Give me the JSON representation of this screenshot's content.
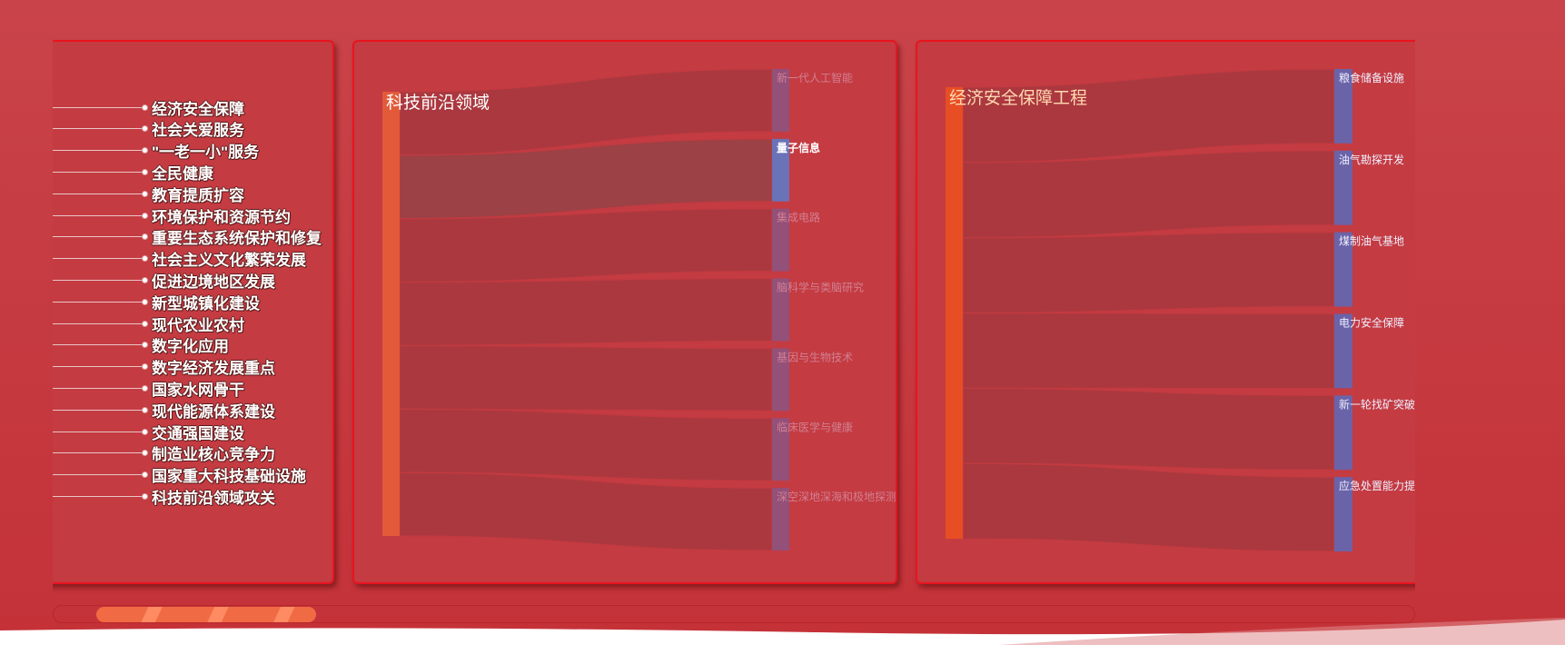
{
  "list_panel": {
    "items": [
      "经济安全保障",
      "社会关爱服务",
      "\"一老一小\"服务",
      "全民健康",
      "教育提质扩容",
      "环境保护和资源节约",
      "重要生态系统保护和修复",
      "社会主义文化繁荣发展",
      "促进边境地区发展",
      "新型城镇化建设",
      "现代农业农村",
      "数字化应用",
      "数字经济发展重点",
      "国家水网骨干",
      "现代能源体系建设",
      "交通强国建设",
      "制造业核心竞争力",
      "国家重大科技基础设施",
      "科技前沿领域攻关"
    ]
  },
  "tech_panel": {
    "source_label": "科技前沿领域",
    "targets": [
      "新一代人工智能",
      "量子信息",
      "集成电路",
      "脑科学与类脑研究",
      "基因与生物技术",
      "临床医学与健康",
      "深空深地深海和极地探测"
    ],
    "highlighted_index": 1
  },
  "econ_panel": {
    "source_label": "经济安全保障工程",
    "targets": [
      "粮食储备设施",
      "油气勘探开发",
      "煤制油气基地",
      "电力安全保障",
      "新一轮找矿突破",
      "应急处置能力提"
    ]
  },
  "colors": {
    "source_node": "#e35a3a",
    "source_node_econ": "#e84e24",
    "target_node": "#6b63a8",
    "target_node_active": "#6a72b8",
    "link": "#a8383f",
    "link_active": "#9a4147",
    "border": "#e8141f"
  }
}
